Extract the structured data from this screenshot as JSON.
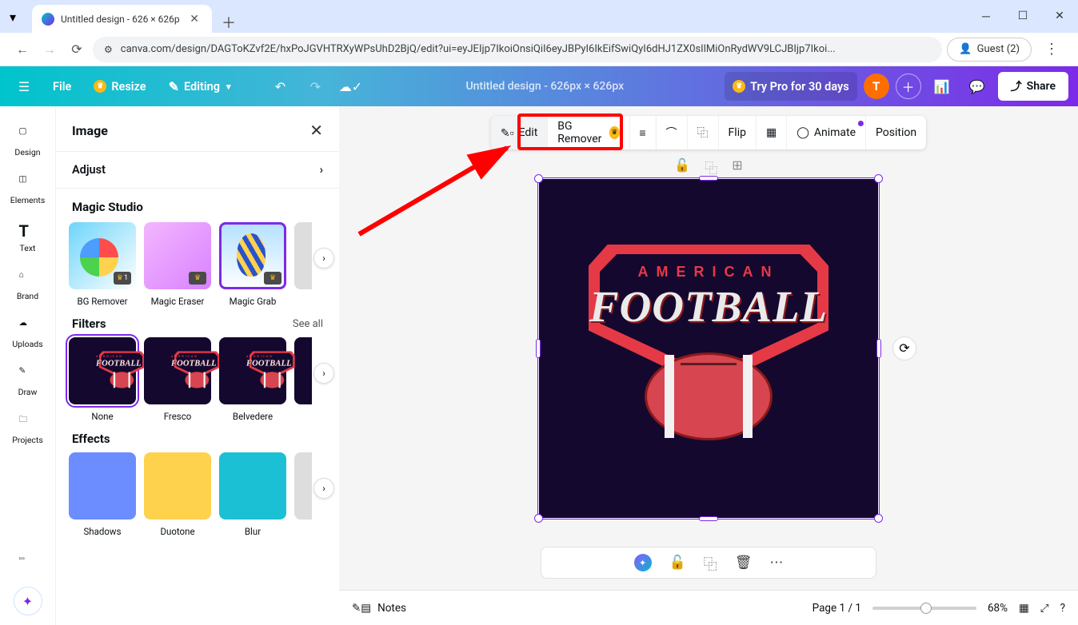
{
  "browser": {
    "tab_title": "Untitled design - 626 × 626p",
    "url": "canva.com/design/DAGToKZvf2E/hxPoJGVHTRXyWPsUhD2BjQ/edit?ui=eyJEIjp7IkoiOnsiQiI6eyJBPyI6IkEifSwiQyI6dHJ1ZX0sIlMiOnRydWV9LCJBIjp7Ikoi...",
    "guest_label": "Guest (2)"
  },
  "toolbar": {
    "file": "File",
    "resize": "Resize",
    "editing": "Editing",
    "doc_title": "Untitled design - 626px × 626px",
    "try_pro": "Try Pro for 30 days",
    "avatar_letter": "T",
    "share": "Share"
  },
  "rail": {
    "design": "Design",
    "elements": "Elements",
    "text": "Text",
    "brand": "Brand",
    "uploads": "Uploads",
    "draw": "Draw",
    "projects": "Projects"
  },
  "panel": {
    "title": "Image",
    "adjust": "Adjust",
    "magic_studio": "Magic Studio",
    "filters": "Filters",
    "effects": "Effects",
    "see_all": "See all",
    "magic": {
      "bg_remover": "BG Remover",
      "magic_eraser": "Magic Eraser",
      "magic_grab": "Magic Grab"
    },
    "filter_items": {
      "none": "None",
      "fresco": "Fresco",
      "belvedere": "Belvedere"
    },
    "effect_items": {
      "shadows": "Shadows",
      "duotone": "Duotone",
      "blur": "Blur"
    }
  },
  "context": {
    "edit": "Edit",
    "bg_remover": "BG Remover",
    "flip": "Flip",
    "animate": "Animate",
    "position": "Position"
  },
  "design": {
    "text_top": "AMERICAN",
    "text_main": "FOOTBALL"
  },
  "bottom": {
    "notes": "Notes",
    "page_info": "Page 1 / 1",
    "zoom": "68%"
  }
}
